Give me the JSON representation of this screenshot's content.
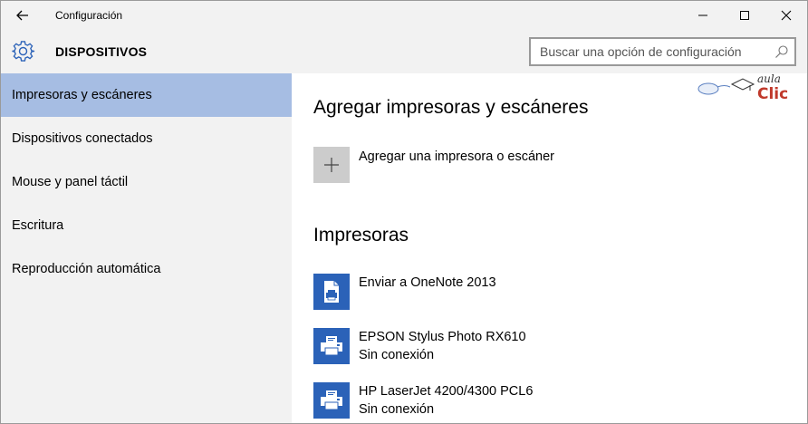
{
  "window": {
    "title": "Configuración",
    "back_icon": "arrow-left-icon",
    "controls": [
      "minimize-icon",
      "maximize-icon",
      "close-icon"
    ]
  },
  "header": {
    "icon": "gear-icon",
    "title": "DISPOSITIVOS",
    "search": {
      "placeholder": "Buscar una opción de configuración",
      "value": "",
      "icon": "search-icon"
    }
  },
  "sidebar": {
    "items": [
      {
        "label": "Impresoras y escáneres",
        "active": true
      },
      {
        "label": "Dispositivos conectados",
        "active": false
      },
      {
        "label": "Mouse y panel táctil",
        "active": false
      },
      {
        "label": "Escritura",
        "active": false
      },
      {
        "label": "Reproducción automática",
        "active": false
      }
    ]
  },
  "main": {
    "add_section": {
      "title": "Agregar impresoras y escáneres",
      "add_label": "Agregar una impresora o escáner",
      "add_icon": "plus-icon"
    },
    "printers_section": {
      "title": "Impresoras",
      "printers": [
        {
          "name": "Enviar a OneNote 2013",
          "status": "",
          "icon": "document-printer-icon"
        },
        {
          "name": "EPSON Stylus Photo RX610",
          "status": "Sin conexión",
          "icon": "printer-icon"
        },
        {
          "name": "HP LaserJet 4200/4300 PCL6",
          "status": "Sin conexión",
          "icon": "printer-icon"
        }
      ]
    }
  },
  "watermark": {
    "top": "aula",
    "bottom": "Clic"
  },
  "colors": {
    "accent_blue": "#2b62b8",
    "selection": "#a6bde3",
    "chrome": "#f2f2f2",
    "watermark_red": "#c0392b"
  }
}
